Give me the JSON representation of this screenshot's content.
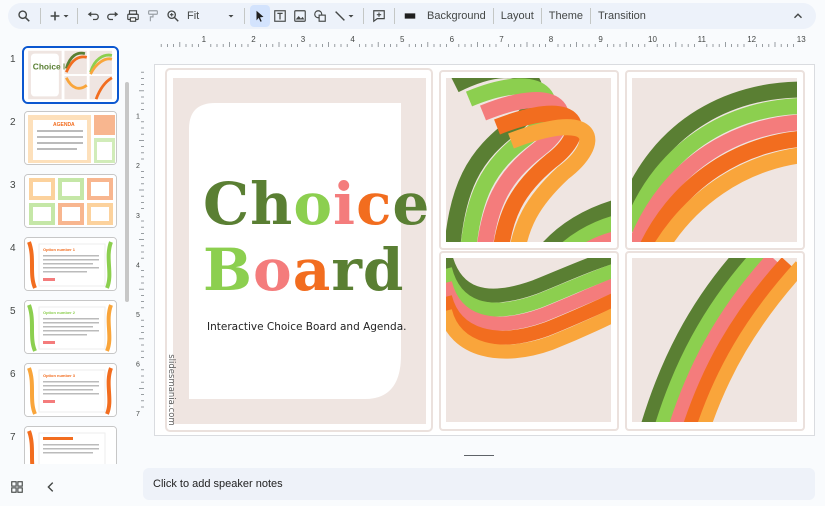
{
  "toolbar": {
    "zoom_value": "Fit",
    "background_label": "Background",
    "layout_label": "Layout",
    "theme_label": "Theme",
    "transition_label": "Transition"
  },
  "ruler": {
    "h_ticks": [
      "1",
      "2",
      "3",
      "4",
      "5",
      "6",
      "7",
      "8",
      "9",
      "10",
      "11",
      "12",
      "13"
    ],
    "v_ticks": [
      "1",
      "2",
      "3",
      "4",
      "5",
      "6",
      "7"
    ]
  },
  "filmstrip": {
    "slides": [
      {
        "number": "1",
        "title": "Choice Board",
        "selected": true
      },
      {
        "number": "2",
        "title": "AGENDA",
        "selected": false
      },
      {
        "number": "3",
        "title": "",
        "selected": false
      },
      {
        "number": "4",
        "title": "Option number 1",
        "selected": false
      },
      {
        "number": "5",
        "title": "Option number 2",
        "selected": false
      },
      {
        "number": "6",
        "title": "Option number 3",
        "selected": false
      },
      {
        "number": "7",
        "title": "",
        "selected": false
      }
    ]
  },
  "slide": {
    "title_line1": "Choice",
    "title_line2": "Board",
    "subtitle": "Interactive Choice Board and Agenda.",
    "credit": "slidesmania.com"
  },
  "notes": {
    "placeholder": "Click to add speaker notes"
  },
  "colors": {
    "dark_green": "#5a7f33",
    "light_green": "#8ccf4f",
    "pink": "#f47c7c",
    "orange": "#f26d1f",
    "light_orange": "#f9a53b",
    "panel_bg": "#efe5e1"
  }
}
